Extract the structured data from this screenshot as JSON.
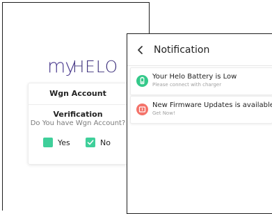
{
  "verification": {
    "logo_my": "my",
    "logo_helo": "HELO",
    "title": "Wgn Account Verification",
    "question": "Do You have Wgn Account?",
    "options": [
      {
        "label": "Yes",
        "checked": false
      },
      {
        "label": "No",
        "checked": true
      }
    ]
  },
  "notifications_screen": {
    "title": "Notification",
    "items": [
      {
        "title": "Your Helo Battery is Low",
        "subtitle": "Please connect with charger",
        "icon": "battery-icon",
        "color": "#34c98a"
      },
      {
        "title": "New Firmware Updates is available",
        "subtitle": "Get Now!",
        "icon": "firmware-update-icon",
        "color": "#f4736a"
      }
    ]
  },
  "colors": {
    "accent_green": "#3fcf9a",
    "logo_purple": "#3b2e7a",
    "alert_red": "#f4736a"
  }
}
